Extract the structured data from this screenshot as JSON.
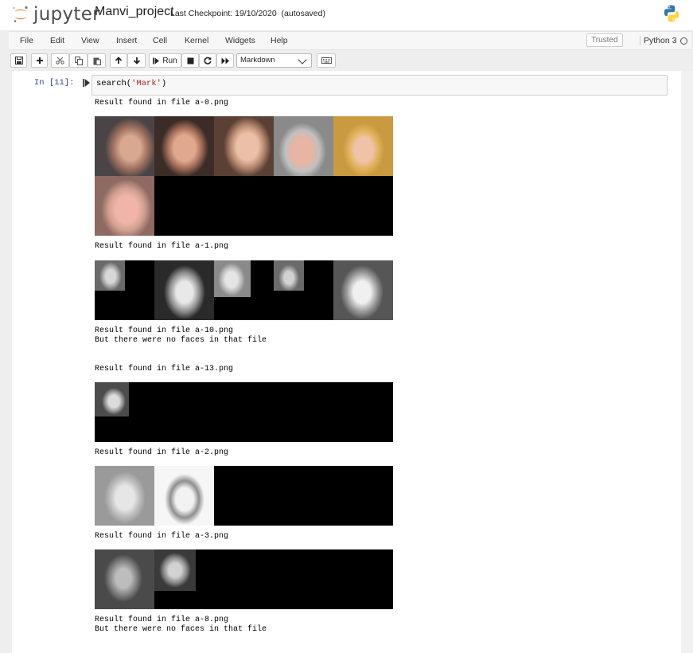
{
  "header": {
    "logo_text": "jupyter",
    "notebook_name": "Manvi_project",
    "checkpoint": "Last Checkpoint: 19/10/2020",
    "autosave": "(autosaved)",
    "logo_icon": "jupyter-logo-icon",
    "kernel_logo_icon": "python-logo-icon"
  },
  "menu": {
    "items": [
      "File",
      "Edit",
      "View",
      "Insert",
      "Cell",
      "Kernel",
      "Widgets",
      "Help"
    ],
    "trusted": "Trusted",
    "kernel": "Python 3"
  },
  "toolbar": {
    "run_label": "Run",
    "cell_type": "Markdown",
    "icons": [
      "save-icon",
      "plus-icon",
      "cut-icon",
      "copy-icon",
      "paste-icon",
      "arrow-up-icon",
      "arrow-down-icon",
      "run-icon",
      "stop-icon",
      "restart-icon",
      "fast-forward-icon",
      "keyboard-icon"
    ]
  },
  "cell": {
    "prompt": "In [11]:",
    "code_fn": "search(",
    "code_arg": "'Mark'",
    "code_end": ")"
  },
  "outputs": [
    {
      "text": "Result found in file a-0.png",
      "faces": 6
    },
    {
      "text": "Result found in file a-1.png",
      "faces": 5
    },
    {
      "text": "Result found in file a-10.png\nBut there were no faces in that file",
      "faces": 0
    },
    {
      "text": "Result found in file a-13.png",
      "faces": 1
    },
    {
      "text": "Result found in file a-2.png",
      "faces": 2
    },
    {
      "text": "Result found in file a-3.png",
      "faces": 2
    },
    {
      "text": "Result found in file a-8.png\nBut there were no faces in that file",
      "faces": 0
    }
  ],
  "colors": {
    "prompt": "#303f9f",
    "string": "#ba2121",
    "logo_orange": "#f37726"
  }
}
